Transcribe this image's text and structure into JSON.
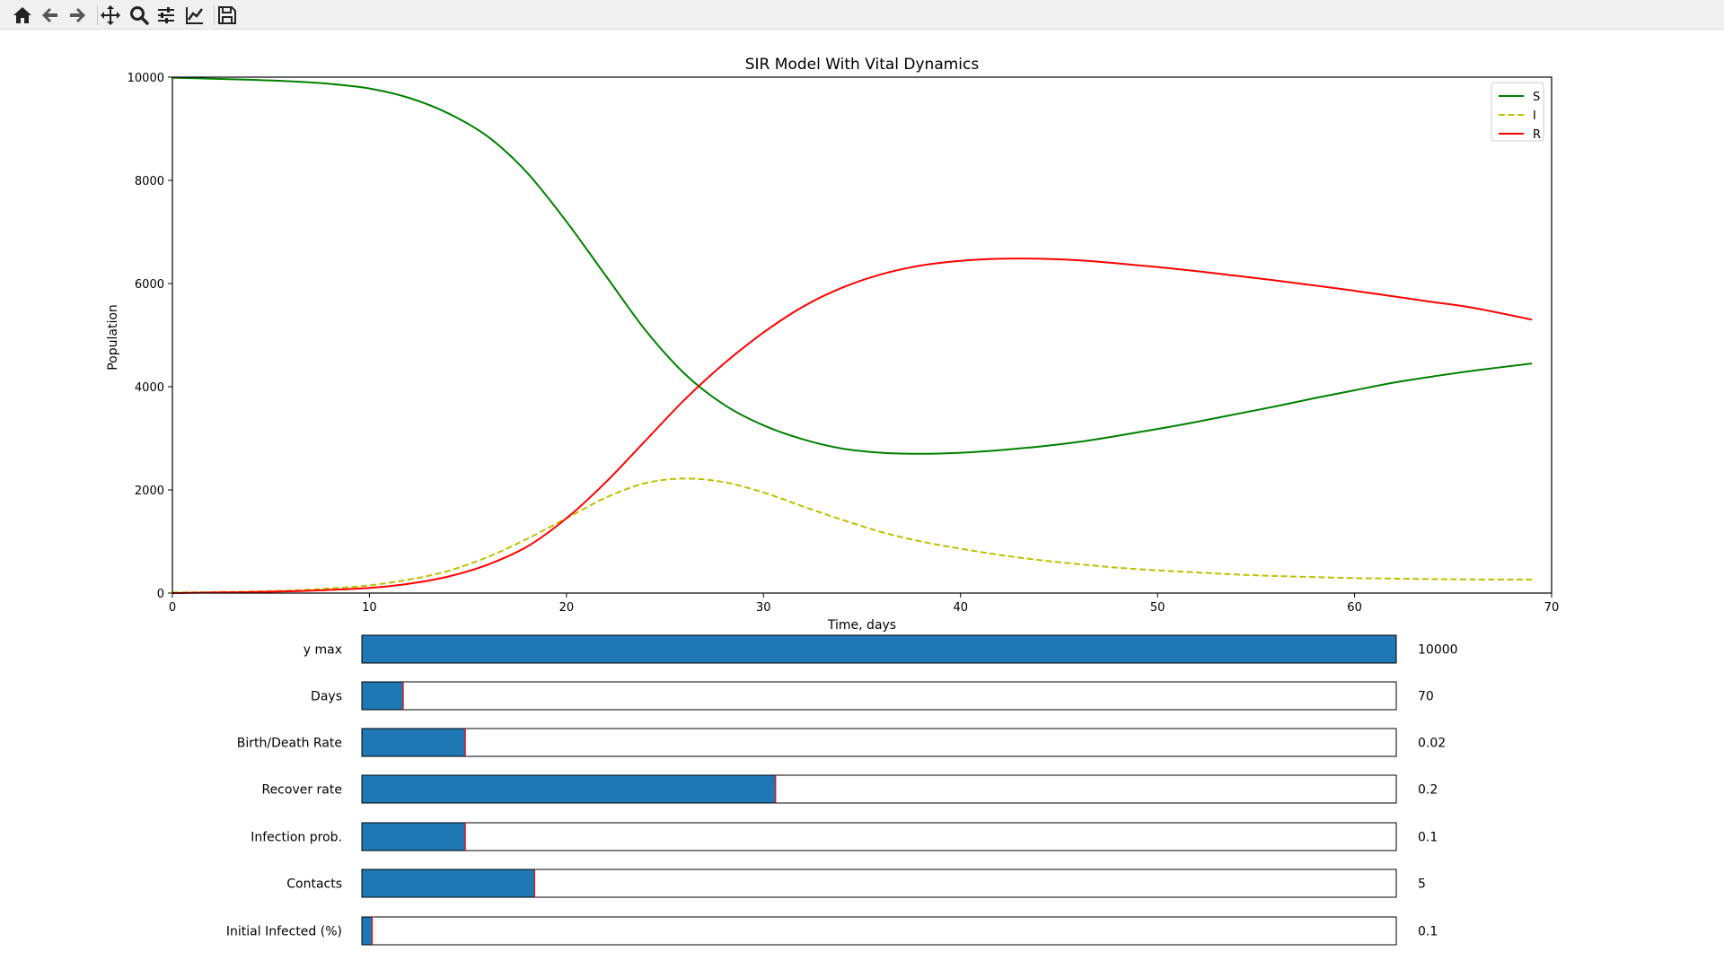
{
  "toolbar": {
    "buttons": [
      {
        "name": "home-icon",
        "tooltip": "Reset original view"
      },
      {
        "name": "back-icon",
        "tooltip": "Back to previous view"
      },
      {
        "name": "forward-icon",
        "tooltip": "Forward to next view"
      },
      {
        "name": "pan-icon",
        "tooltip": "Pan axes"
      },
      {
        "name": "zoom-icon",
        "tooltip": "Zoom to rectangle"
      },
      {
        "name": "subplots-icon",
        "tooltip": "Configure subplots"
      },
      {
        "name": "customize-icon",
        "tooltip": "Edit axis, curve and image parameters"
      },
      {
        "name": "save-icon",
        "tooltip": "Save the figure"
      }
    ]
  },
  "chart_data": {
    "type": "line",
    "title": "SIR Model With Vital Dynamics",
    "xlabel": "Time, days",
    "ylabel": "Population",
    "xlim": [
      0,
      70
    ],
    "ylim": [
      0,
      10000
    ],
    "xticks": [
      "0",
      "10",
      "20",
      "30",
      "40",
      "50",
      "60",
      "70"
    ],
    "yticks": [
      "0",
      "2000",
      "4000",
      "6000",
      "8000",
      "10000"
    ],
    "grid": false,
    "legend_position": "top-right",
    "x": [
      0,
      2,
      4,
      6,
      8,
      10,
      12,
      14,
      16,
      18,
      20,
      22,
      24,
      26,
      28,
      30,
      32,
      34,
      36,
      38,
      40,
      42,
      44,
      46,
      48,
      50,
      52,
      54,
      56,
      58,
      60,
      62,
      64,
      66,
      69
    ],
    "series": [
      {
        "name": "S",
        "color": "#008000",
        "dash": "solid",
        "values": [
          9990,
          9970,
          9950,
          9920,
          9870,
          9780,
          9600,
          9300,
          8850,
          8150,
          7200,
          6150,
          5100,
          4250,
          3650,
          3250,
          2980,
          2800,
          2720,
          2700,
          2720,
          2770,
          2840,
          2930,
          3050,
          3180,
          3320,
          3470,
          3620,
          3780,
          3930,
          4080,
          4200,
          4310,
          4450
        ]
      },
      {
        "name": "I",
        "color": "#bfbf00",
        "dash": "dashed",
        "values": [
          10,
          18,
          30,
          50,
          90,
          150,
          260,
          430,
          700,
          1050,
          1450,
          1850,
          2130,
          2220,
          2150,
          1950,
          1680,
          1420,
          1180,
          1000,
          860,
          740,
          640,
          560,
          490,
          440,
          400,
          360,
          330,
          310,
          290,
          280,
          270,
          265,
          260
        ]
      },
      {
        "name": "R",
        "color": "#ff0000",
        "dash": "solid",
        "values": [
          0,
          10,
          20,
          35,
          60,
          100,
          180,
          320,
          550,
          900,
          1450,
          2150,
          2950,
          3750,
          4450,
          5050,
          5550,
          5920,
          6180,
          6350,
          6440,
          6480,
          6480,
          6450,
          6390,
          6320,
          6240,
          6150,
          6060,
          5960,
          5860,
          5750,
          5640,
          5530,
          5300
        ]
      }
    ]
  },
  "sliders": [
    {
      "label": "y max",
      "value_text": "10000",
      "fill_fraction": 1.0
    },
    {
      "label": "Days",
      "value_text": "70",
      "fill_fraction": 0.04
    },
    {
      "label": "Birth/Death Rate",
      "value_text": "0.02",
      "fill_fraction": 0.1
    },
    {
      "label": "Recover rate",
      "value_text": "0.2",
      "fill_fraction": 0.4
    },
    {
      "label": "Infection prob.",
      "value_text": "0.1",
      "fill_fraction": 0.1
    },
    {
      "label": "Contacts",
      "value_text": "5",
      "fill_fraction": 0.167
    },
    {
      "label": "Initial Infected (%)",
      "value_text": "0.1",
      "fill_fraction": 0.01
    }
  ],
  "colors": {
    "slider_fill": "#1f77b4",
    "slider_handle": "#ff0000",
    "axis": "#000000"
  }
}
